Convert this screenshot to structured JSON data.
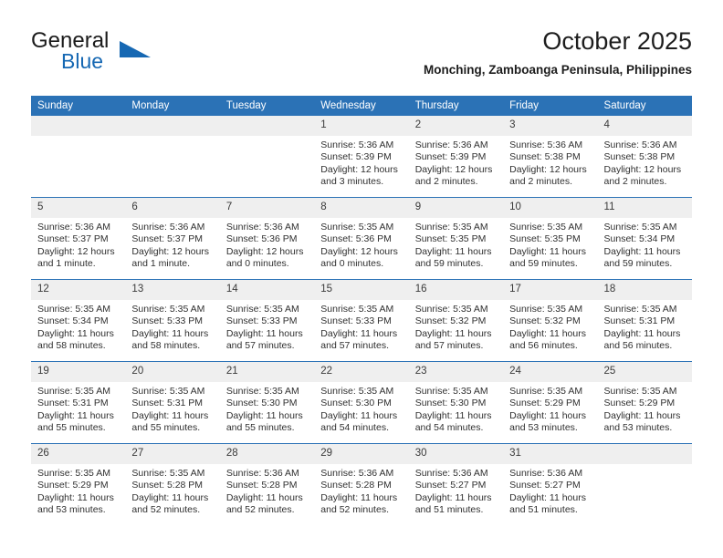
{
  "brand": {
    "line1": "General",
    "line2": "Blue",
    "accent_color": "#1668b3",
    "triangle_icon": "brand-triangle-icon"
  },
  "header": {
    "title": "October 2025",
    "subtitle": "Monching, Zamboanga Peninsula, Philippines"
  },
  "theme": {
    "header_row_bg": "#2b72b6",
    "daynum_bg": "#efefef",
    "text_color": "#303030"
  },
  "weekday_headers": [
    "Sunday",
    "Monday",
    "Tuesday",
    "Wednesday",
    "Thursday",
    "Friday",
    "Saturday"
  ],
  "weeks": [
    [
      {
        "day": "",
        "sunrise": "",
        "sunset": "",
        "daylight": "",
        "daylight2": ""
      },
      {
        "day": "",
        "sunrise": "",
        "sunset": "",
        "daylight": "",
        "daylight2": ""
      },
      {
        "day": "",
        "sunrise": "",
        "sunset": "",
        "daylight": "",
        "daylight2": ""
      },
      {
        "day": "1",
        "sunrise": "Sunrise: 5:36 AM",
        "sunset": "Sunset: 5:39 PM",
        "daylight": "Daylight: 12 hours",
        "daylight2": "and 3 minutes."
      },
      {
        "day": "2",
        "sunrise": "Sunrise: 5:36 AM",
        "sunset": "Sunset: 5:39 PM",
        "daylight": "Daylight: 12 hours",
        "daylight2": "and 2 minutes."
      },
      {
        "day": "3",
        "sunrise": "Sunrise: 5:36 AM",
        "sunset": "Sunset: 5:38 PM",
        "daylight": "Daylight: 12 hours",
        "daylight2": "and 2 minutes."
      },
      {
        "day": "4",
        "sunrise": "Sunrise: 5:36 AM",
        "sunset": "Sunset: 5:38 PM",
        "daylight": "Daylight: 12 hours",
        "daylight2": "and 2 minutes."
      }
    ],
    [
      {
        "day": "5",
        "sunrise": "Sunrise: 5:36 AM",
        "sunset": "Sunset: 5:37 PM",
        "daylight": "Daylight: 12 hours",
        "daylight2": "and 1 minute."
      },
      {
        "day": "6",
        "sunrise": "Sunrise: 5:36 AM",
        "sunset": "Sunset: 5:37 PM",
        "daylight": "Daylight: 12 hours",
        "daylight2": "and 1 minute."
      },
      {
        "day": "7",
        "sunrise": "Sunrise: 5:36 AM",
        "sunset": "Sunset: 5:36 PM",
        "daylight": "Daylight: 12 hours",
        "daylight2": "and 0 minutes."
      },
      {
        "day": "8",
        "sunrise": "Sunrise: 5:35 AM",
        "sunset": "Sunset: 5:36 PM",
        "daylight": "Daylight: 12 hours",
        "daylight2": "and 0 minutes."
      },
      {
        "day": "9",
        "sunrise": "Sunrise: 5:35 AM",
        "sunset": "Sunset: 5:35 PM",
        "daylight": "Daylight: 11 hours",
        "daylight2": "and 59 minutes."
      },
      {
        "day": "10",
        "sunrise": "Sunrise: 5:35 AM",
        "sunset": "Sunset: 5:35 PM",
        "daylight": "Daylight: 11 hours",
        "daylight2": "and 59 minutes."
      },
      {
        "day": "11",
        "sunrise": "Sunrise: 5:35 AM",
        "sunset": "Sunset: 5:34 PM",
        "daylight": "Daylight: 11 hours",
        "daylight2": "and 59 minutes."
      }
    ],
    [
      {
        "day": "12",
        "sunrise": "Sunrise: 5:35 AM",
        "sunset": "Sunset: 5:34 PM",
        "daylight": "Daylight: 11 hours",
        "daylight2": "and 58 minutes."
      },
      {
        "day": "13",
        "sunrise": "Sunrise: 5:35 AM",
        "sunset": "Sunset: 5:33 PM",
        "daylight": "Daylight: 11 hours",
        "daylight2": "and 58 minutes."
      },
      {
        "day": "14",
        "sunrise": "Sunrise: 5:35 AM",
        "sunset": "Sunset: 5:33 PM",
        "daylight": "Daylight: 11 hours",
        "daylight2": "and 57 minutes."
      },
      {
        "day": "15",
        "sunrise": "Sunrise: 5:35 AM",
        "sunset": "Sunset: 5:33 PM",
        "daylight": "Daylight: 11 hours",
        "daylight2": "and 57 minutes."
      },
      {
        "day": "16",
        "sunrise": "Sunrise: 5:35 AM",
        "sunset": "Sunset: 5:32 PM",
        "daylight": "Daylight: 11 hours",
        "daylight2": "and 57 minutes."
      },
      {
        "day": "17",
        "sunrise": "Sunrise: 5:35 AM",
        "sunset": "Sunset: 5:32 PM",
        "daylight": "Daylight: 11 hours",
        "daylight2": "and 56 minutes."
      },
      {
        "day": "18",
        "sunrise": "Sunrise: 5:35 AM",
        "sunset": "Sunset: 5:31 PM",
        "daylight": "Daylight: 11 hours",
        "daylight2": "and 56 minutes."
      }
    ],
    [
      {
        "day": "19",
        "sunrise": "Sunrise: 5:35 AM",
        "sunset": "Sunset: 5:31 PM",
        "daylight": "Daylight: 11 hours",
        "daylight2": "and 55 minutes."
      },
      {
        "day": "20",
        "sunrise": "Sunrise: 5:35 AM",
        "sunset": "Sunset: 5:31 PM",
        "daylight": "Daylight: 11 hours",
        "daylight2": "and 55 minutes."
      },
      {
        "day": "21",
        "sunrise": "Sunrise: 5:35 AM",
        "sunset": "Sunset: 5:30 PM",
        "daylight": "Daylight: 11 hours",
        "daylight2": "and 55 minutes."
      },
      {
        "day": "22",
        "sunrise": "Sunrise: 5:35 AM",
        "sunset": "Sunset: 5:30 PM",
        "daylight": "Daylight: 11 hours",
        "daylight2": "and 54 minutes."
      },
      {
        "day": "23",
        "sunrise": "Sunrise: 5:35 AM",
        "sunset": "Sunset: 5:30 PM",
        "daylight": "Daylight: 11 hours",
        "daylight2": "and 54 minutes."
      },
      {
        "day": "24",
        "sunrise": "Sunrise: 5:35 AM",
        "sunset": "Sunset: 5:29 PM",
        "daylight": "Daylight: 11 hours",
        "daylight2": "and 53 minutes."
      },
      {
        "day": "25",
        "sunrise": "Sunrise: 5:35 AM",
        "sunset": "Sunset: 5:29 PM",
        "daylight": "Daylight: 11 hours",
        "daylight2": "and 53 minutes."
      }
    ],
    [
      {
        "day": "26",
        "sunrise": "Sunrise: 5:35 AM",
        "sunset": "Sunset: 5:29 PM",
        "daylight": "Daylight: 11 hours",
        "daylight2": "and 53 minutes."
      },
      {
        "day": "27",
        "sunrise": "Sunrise: 5:35 AM",
        "sunset": "Sunset: 5:28 PM",
        "daylight": "Daylight: 11 hours",
        "daylight2": "and 52 minutes."
      },
      {
        "day": "28",
        "sunrise": "Sunrise: 5:36 AM",
        "sunset": "Sunset: 5:28 PM",
        "daylight": "Daylight: 11 hours",
        "daylight2": "and 52 minutes."
      },
      {
        "day": "29",
        "sunrise": "Sunrise: 5:36 AM",
        "sunset": "Sunset: 5:28 PM",
        "daylight": "Daylight: 11 hours",
        "daylight2": "and 52 minutes."
      },
      {
        "day": "30",
        "sunrise": "Sunrise: 5:36 AM",
        "sunset": "Sunset: 5:27 PM",
        "daylight": "Daylight: 11 hours",
        "daylight2": "and 51 minutes."
      },
      {
        "day": "31",
        "sunrise": "Sunrise: 5:36 AM",
        "sunset": "Sunset: 5:27 PM",
        "daylight": "Daylight: 11 hours",
        "daylight2": "and 51 minutes."
      },
      {
        "day": "",
        "sunrise": "",
        "sunset": "",
        "daylight": "",
        "daylight2": ""
      }
    ]
  ]
}
